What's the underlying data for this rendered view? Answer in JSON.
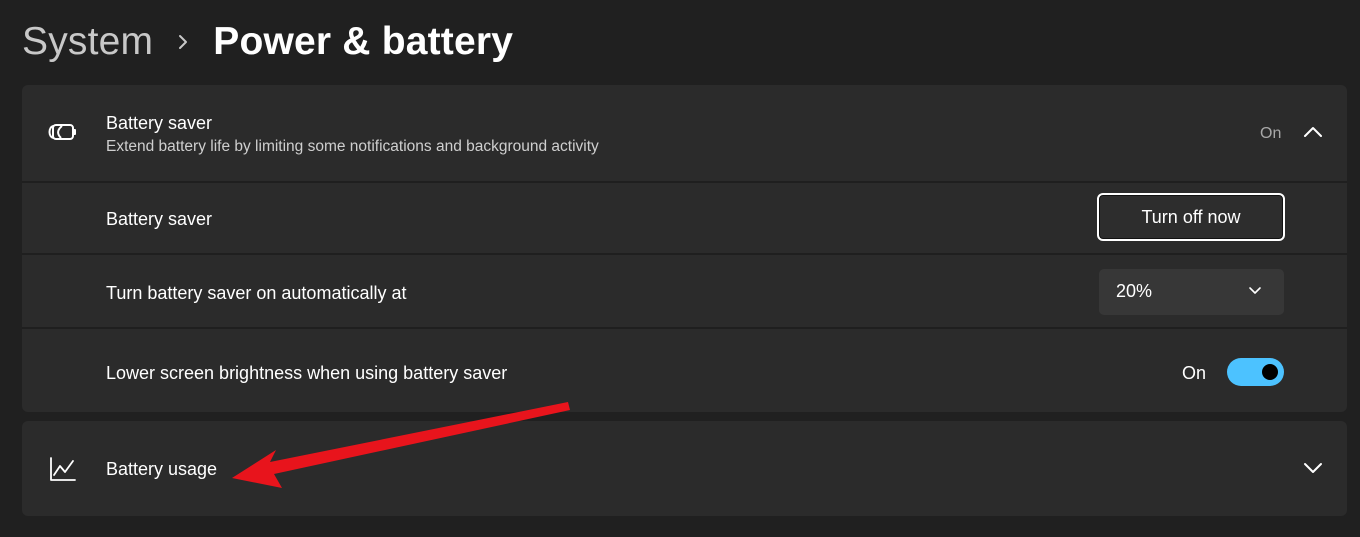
{
  "breadcrumb": {
    "parent": "System",
    "current": "Power & battery"
  },
  "battery_saver_card": {
    "header": {
      "icon": "battery-saver-icon",
      "title": "Battery saver",
      "subtitle": "Extend battery life by limiting some notifications and background activity",
      "status": "On",
      "expanded": true
    },
    "battery_saver_row": {
      "label": "Battery saver",
      "button_label": "Turn off now"
    },
    "auto_row": {
      "label": "Turn battery saver on automatically at",
      "selected_value": "20%"
    },
    "brightness_row": {
      "label": "Lower screen brightness when using battery saver",
      "toggle_label": "On",
      "toggle_on": true
    }
  },
  "battery_usage_card": {
    "icon": "line-chart-icon",
    "title": "Battery usage",
    "expanded": false
  },
  "colors": {
    "background": "#202020",
    "card": "#2b2b2b",
    "accent": "#4cc2ff",
    "annotation_arrow": "#e8141c"
  }
}
